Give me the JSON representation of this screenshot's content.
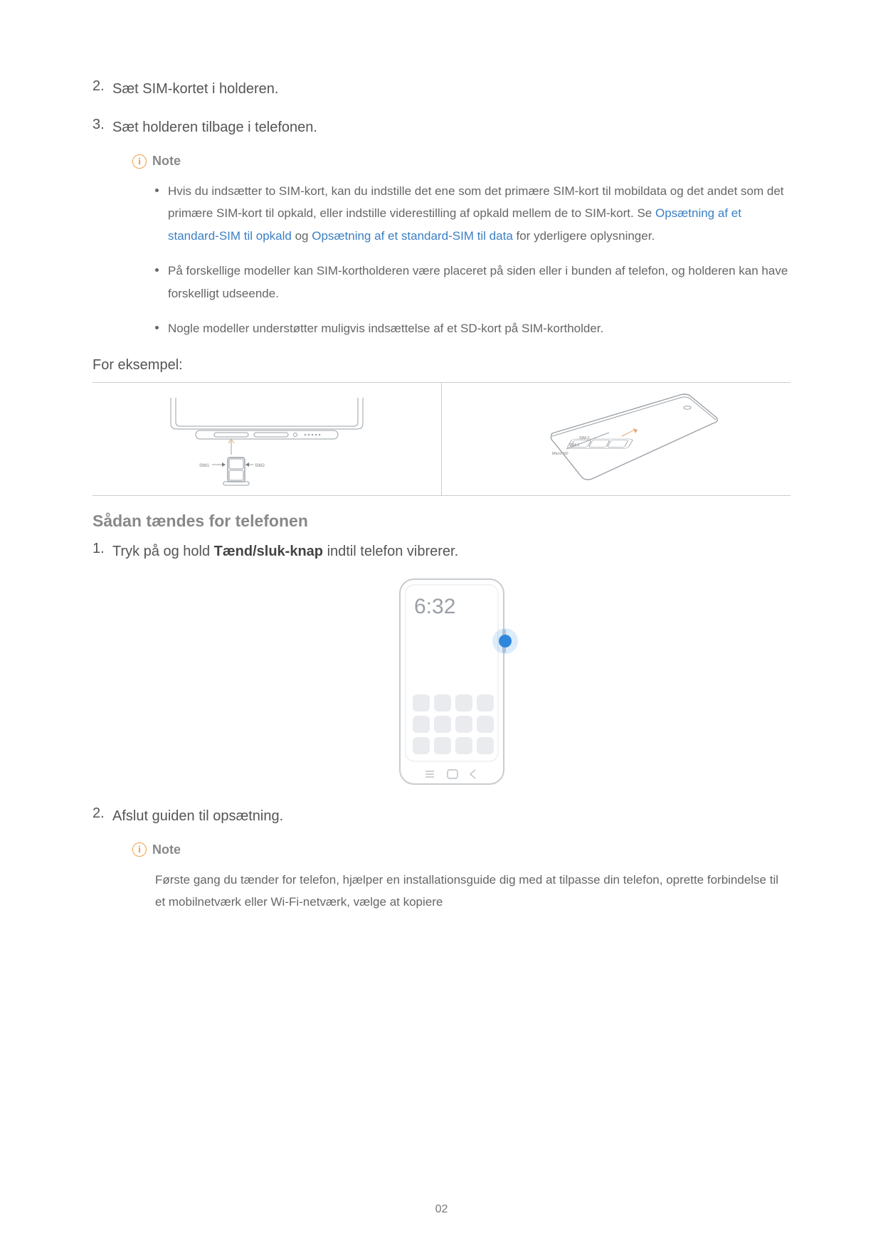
{
  "steps_top": [
    {
      "num": "2.",
      "text": "Sæt SIM-kortet i holderen."
    },
    {
      "num": "3.",
      "text": "Sæt holderen tilbage i telefonen."
    }
  ],
  "note1": {
    "label": "Note",
    "bullets": [
      {
        "pre": "Hvis du indsætter to SIM-kort, kan du indstille det ene som det primære SIM-kort til mobildata og det andet som det primære SIM-kort til opkald, eller indstille viderestilling af opkald mellem de to SIM-kort. Se ",
        "link1": "Opsætning af et standard-SIM til opkald",
        "mid": " og ",
        "link2": "Opsætning af et standard-SIM til data",
        "post": " for yderligere oplysninger."
      },
      {
        "text": "På forskellige modeller kan SIM-kortholderen være placeret på siden eller i bunden af telefon, og holderen kan have forskelligt udseende."
      },
      {
        "text": "Nogle modeller understøtter muligvis indsættelse af et SD-kort på SIM-kortholder."
      }
    ]
  },
  "for_example": "For eksempel:",
  "diagram_labels": {
    "sim1": "SIM1",
    "sim2_left": "SIM2",
    "sim2": "SIM 2",
    "sim1b": "SIM 1",
    "microsd": "Micro SD"
  },
  "section_heading": "Sådan tændes for telefonen",
  "steps_bottom": [
    {
      "num": "1.",
      "pre": "Tryk på og hold ",
      "bold": "Tænd/sluk-knap",
      "post": " indtil telefon vibrerer."
    },
    {
      "num": "2.",
      "text": "Afslut guiden til opsætning."
    }
  ],
  "phone_time": "6:32",
  "note2": {
    "label": "Note",
    "text": "Første gang du tænder for telefon, hjælper en installationsguide dig med at tilpasse din telefon, oprette forbindelse til et mobilnetværk eller Wi-Fi-netværk, vælge at kopiere"
  },
  "page_number": "02"
}
